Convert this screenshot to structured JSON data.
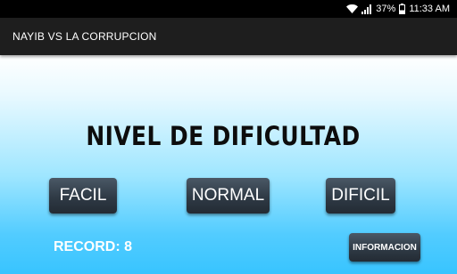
{
  "status_bar": {
    "battery": "37%",
    "time": "11:33 AM",
    "icons": [
      "wifi-icon",
      "signal-icon",
      "battery-icon"
    ]
  },
  "action_bar": {
    "title": "NAYIB VS LA CORRUPCION"
  },
  "main": {
    "heading": "NIVEL DE DIFICULTAD",
    "buttons": {
      "facil": "FACIL",
      "normal": "NORMAL",
      "dificil": "DIFICIL",
      "informacion": "INFORMACION"
    },
    "record": "RECORD: 8"
  },
  "colors": {
    "status_bar_bg": "#000000",
    "action_bar_bg": "#1e1e1e",
    "gradient_top": "#ffffff",
    "gradient_bottom": "#38c4ff",
    "button_bg": "#2f3a45"
  }
}
